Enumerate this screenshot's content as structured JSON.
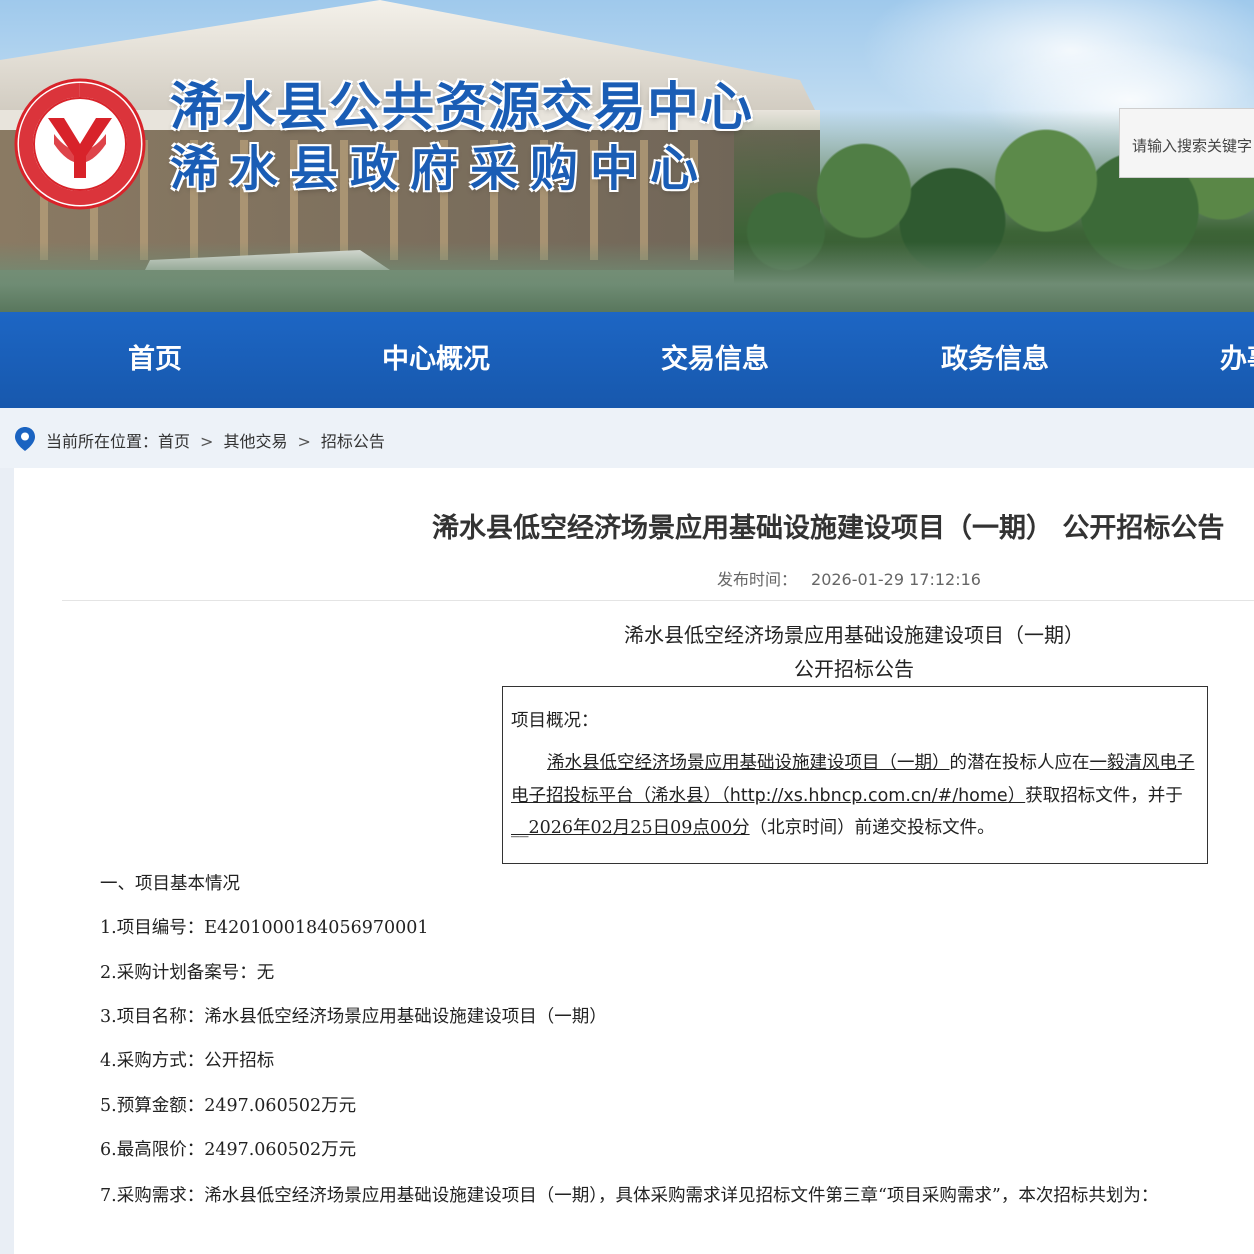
{
  "header": {
    "title_line1": "浠水县公共资源交易中心",
    "title_line2": "浠水县政府采购中心",
    "logo_icon": "trade-in-public-resources-logo",
    "search_placeholder": "请输入搜索关键字"
  },
  "nav": {
    "items": [
      {
        "label": "首页"
      },
      {
        "label": "中心概况"
      },
      {
        "label": "交易信息"
      },
      {
        "label": "政务信息"
      },
      {
        "label": "办事"
      }
    ]
  },
  "breadcrumb": {
    "prefix": "当前所在位置：",
    "items": [
      "首页",
      "其他交易",
      "招标公告"
    ],
    "separator": ">"
  },
  "article": {
    "title": "浠水县低空经济场景应用基础设施建设项目（一期） 公开招标公告",
    "publish_label": "发布时间：",
    "publish_time": "2026-01-29 17:12:16",
    "doc_title_line1": "浠水县低空经济场景应用基础设施建设项目（一期）",
    "doc_title_line2": "公开招标公告",
    "overview": {
      "title": "项目概况：",
      "project_name": "浠水县低空经济场景应用基础设施建设项目（一期）",
      "text1": "的潜在投标人应在",
      "platform": "一毅清风电子电子招投标平台（浠水县）（",
      "platform_url": "http://xs.hbncp.com.cn/#/home",
      "platform_close": "）",
      "text2": "获取招标文件，并于",
      "deadline": "__2026年02月25日09点00分",
      "text3": "（北京时间）前递交投标文件。"
    },
    "section1_title": "一、项目基本情况",
    "items": [
      "1.项目编号：E4201000184056970001",
      "2.采购计划备案号：无",
      "3.项目名称：浠水县低空经济场景应用基础设施建设项目（一期）",
      "4.采购方式：公开招标",
      "5.预算金额：2497.060502万元",
      "6.最高限价：2497.060502万元"
    ],
    "item7": "7.采购需求：浠水县低空经济场景应用基础设施建设项目（一期），具体采购需求详见招标文件第三章“项目采购需求”，本次招标共划为："
  },
  "colors": {
    "nav_blue": "#1d66c4",
    "title_blue": "#1a5db5",
    "logo_red": "#d8232a"
  }
}
